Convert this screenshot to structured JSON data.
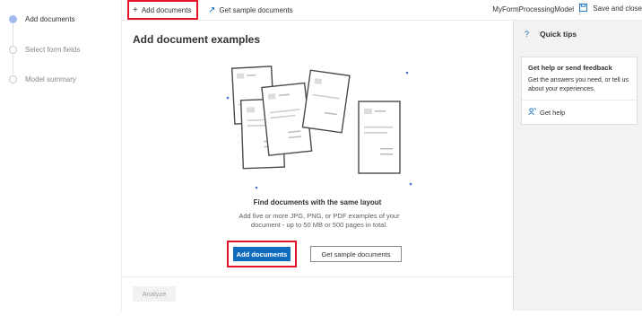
{
  "stepper": {
    "steps": [
      {
        "label": "Add documents",
        "active": true
      },
      {
        "label": "Select form fields",
        "active": false
      },
      {
        "label": "Model summary",
        "active": false
      }
    ]
  },
  "toolbar": {
    "add_documents_label": "Add documents",
    "add_icon": "plus-icon",
    "get_sample_label": "Get sample documents",
    "sample_icon": "arrow-up-right-icon",
    "model_name": "MyFormProcessingModel",
    "save_close_label": "Save and close",
    "save_icon": "save-icon"
  },
  "main": {
    "title": "Add document examples",
    "find_title": "Find documents with the same layout",
    "find_desc": "Add five or more JPG, PNG, or PDF examples of your document - up to 50 MB or 500 pages in total.",
    "add_documents_button": "Add documents",
    "get_sample_button": "Get sample documents",
    "analyze_button": "Analyze"
  },
  "tips": {
    "title": "Quick tips",
    "icon": "question-icon",
    "card_title": "Get help or send feedback",
    "card_desc": "Get the answers you need, or tell us about your experiences.",
    "help_link": "Get help",
    "help_icon": "help-person-icon"
  },
  "colors": {
    "accent": "#0f6cbd",
    "highlight": "#e3132a",
    "panel_bg": "#f3f2f1"
  }
}
